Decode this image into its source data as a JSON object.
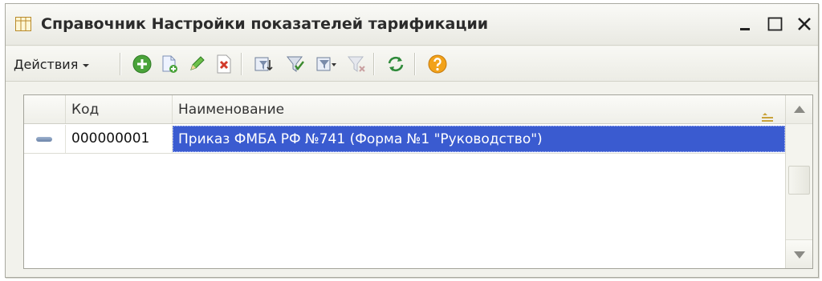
{
  "window": {
    "title": "Справочник Настройки показателей тарификации",
    "title_icon": "table-grid-icon",
    "controls": [
      "minimize-icon",
      "maximize-icon",
      "close-icon"
    ]
  },
  "toolbar": {
    "actions_label": "Действия",
    "buttons": [
      {
        "name": "add-button",
        "icon": "plus-circle-icon"
      },
      {
        "name": "copy-button",
        "icon": "copy-document-icon"
      },
      {
        "name": "edit-button",
        "icon": "pencil-icon"
      },
      {
        "name": "delete-button",
        "icon": "delete-x-icon"
      },
      {
        "name": "filter-by-value-button",
        "icon": "filter-value-icon"
      },
      {
        "name": "filter-button",
        "icon": "filter-check-icon"
      },
      {
        "name": "filter-history-button",
        "icon": "filter-dropdown-icon"
      },
      {
        "name": "clear-filter-button",
        "icon": "filter-clear-icon"
      },
      {
        "name": "refresh-button",
        "icon": "refresh-icon"
      },
      {
        "name": "help-button",
        "icon": "help-question-icon"
      }
    ]
  },
  "table": {
    "columns": {
      "code": "Код",
      "name": "Наименование"
    },
    "rows": [
      {
        "code": "000000001",
        "name": "Приказ ФМБА РФ №741 (Форма №1 \"Руководство\")",
        "selected": true
      }
    ]
  },
  "colors": {
    "selection": "#3a5bd0",
    "add_green": "#4aa33a",
    "delete_red": "#d23a2a",
    "help_orange": "#f2a21a"
  }
}
